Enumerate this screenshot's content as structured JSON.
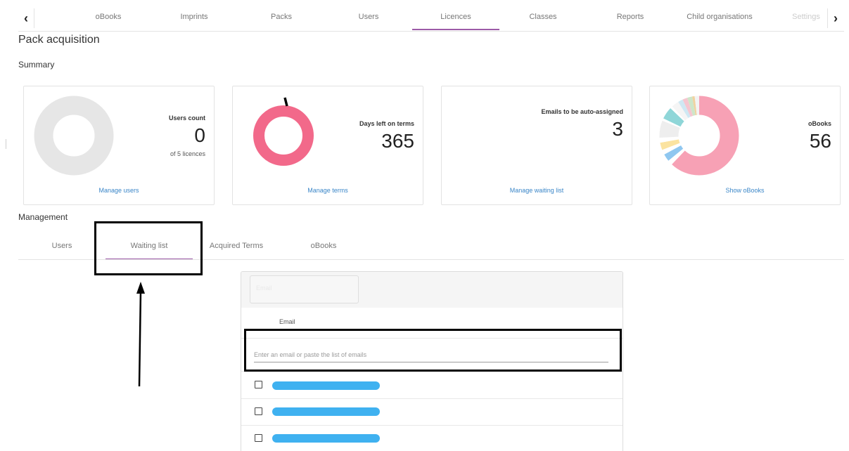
{
  "nav": {
    "tabs": [
      "oBooks",
      "Imprints",
      "Packs",
      "Users",
      "Licences",
      "Classes",
      "Reports",
      "Child organisations",
      "Settings"
    ],
    "active_tab": "Licences",
    "prev_icon": "chevron-left-icon",
    "next_icon": "chevron-right-icon",
    "prev_glyph": "‹",
    "next_glyph": "›"
  },
  "page": {
    "title": "Pack acquisition",
    "summary_title": "Summary",
    "management_title": "Management"
  },
  "cards": [
    {
      "label": "Users count",
      "value": "0",
      "sub": "of 5 licences",
      "link": "Manage users",
      "fill_fraction": 0
    },
    {
      "label": "Days left on terms",
      "value": "365",
      "link": "Manage terms",
      "fill_fraction": 0.99
    },
    {
      "label": "Emails to be auto-assigned",
      "value": "3",
      "link": "Manage waiting list"
    },
    {
      "label": "oBooks",
      "value": "56",
      "link": "Show oBooks"
    }
  ],
  "colors": {
    "accent": "#9c5aa7",
    "link": "#3a86c8",
    "terms_ring": "#f2698a",
    "users_ring": "#e6e6e6",
    "redaction": "#3fb1f0"
  },
  "management": {
    "tabs": [
      "Users",
      "Waiting list",
      "Acquired Terms",
      "oBooks"
    ],
    "active_tab": "Waiting list"
  },
  "waiting_list": {
    "search_placeholder": "Email",
    "column_header": "Email",
    "email_input_placeholder": "Enter an email or paste the list of emails",
    "rows": [
      {
        "checked": false
      },
      {
        "checked": false
      },
      {
        "checked": false
      }
    ]
  }
}
